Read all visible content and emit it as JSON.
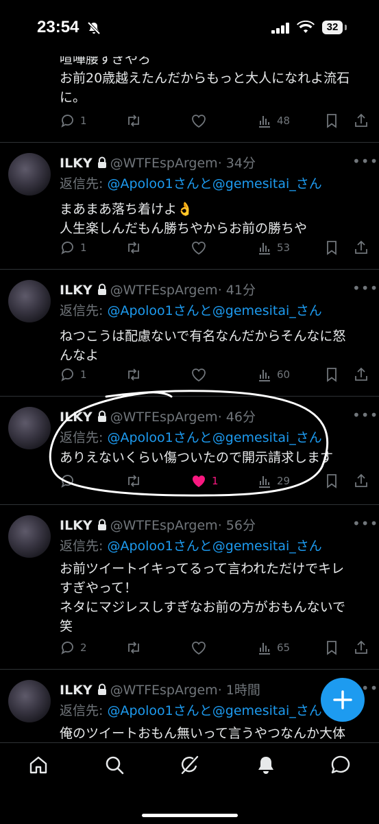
{
  "status_bar": {
    "time": "23:54",
    "battery": "32"
  },
  "top_partial": {
    "line1": "喧嘩腰すぎやろ",
    "line2": "お前20歳越えたんだからもっと大人になれよ流石",
    "line3": "に。",
    "replies": "1",
    "likes": "",
    "views": "48"
  },
  "tweets": [
    {
      "name": "ILKY",
      "handle": "@WTFEspArgem",
      "time": "· 34分",
      "reply_label": "返信先: ",
      "mention1": "@Apoloo1",
      "joiner": "さんと",
      "mention2": "@gemesitai_さん",
      "text_lines": [
        "まあまあ落ち着けよ👌",
        "人生楽しんだもん勝ちやからお前の勝ちや"
      ],
      "replies": "1",
      "likes": "",
      "views": "53",
      "liked": false
    },
    {
      "name": "ILKY",
      "handle": "@WTFEspArgem",
      "time": "· 41分",
      "reply_label": "返信先: ",
      "mention1": "@Apoloo1",
      "joiner": "さんと",
      "mention2": "@gemesitai_さん",
      "text_lines": [
        "ねつこうは配慮ないで有名なんだからそんなに怒",
        "んなよ"
      ],
      "replies": "1",
      "likes": "",
      "views": "60",
      "liked": false
    },
    {
      "name": "ILKY",
      "handle": "@WTFEspArgem",
      "time": "· 46分",
      "reply_label": "返信先: ",
      "mention1": "@Apoloo1",
      "joiner": "さんと",
      "mention2": "@gemesitai_さん",
      "text_lines": [
        "ありえないくらい傷ついたので開示請求します"
      ],
      "replies": "",
      "likes": "1",
      "views": "29",
      "liked": true
    },
    {
      "name": "ILKY",
      "handle": "@WTFEspArgem",
      "time": "· 56分",
      "reply_label": "返信先: ",
      "mention1": "@Apoloo1",
      "joiner": "さんと",
      "mention2": "@gemesitai_さん",
      "text_lines": [
        "お前ツイートイキってるって言われただけでキレ",
        "すぎやって！",
        "ネタにマジレスしすぎなお前の方がおもんないで",
        "笑"
      ],
      "replies": "2",
      "likes": "",
      "views": "65",
      "liked": false
    },
    {
      "name": "ILKY",
      "handle": "@WTFEspArgem",
      "time": "· 1時間",
      "reply_label": "返信先: ",
      "mention1": "@Apoloo1",
      "joiner": "さんと",
      "mention2": "@gemesitai_さん",
      "text_lines": [
        "俺のツイートおもん無いって言うやつなんか大体"
      ],
      "replies": "",
      "likes": "",
      "views": "",
      "liked": false
    }
  ],
  "icons": {
    "status": [
      "bell-off-icon",
      "signal-icon",
      "wifi-icon",
      "battery-icon"
    ],
    "actions": [
      "reply-icon",
      "retweet-icon",
      "like-icon",
      "views-icon",
      "bookmark-icon",
      "share-icon"
    ],
    "nav": [
      "home-icon",
      "search-icon",
      "grok-icon",
      "notifications-icon",
      "messages-icon"
    ],
    "fab": "compose-plus-icon"
  },
  "colors": {
    "accent": "#1d9bf0",
    "like": "#f91880",
    "muted": "#71767b",
    "text": "#e7e9ea",
    "background": "#000000"
  }
}
